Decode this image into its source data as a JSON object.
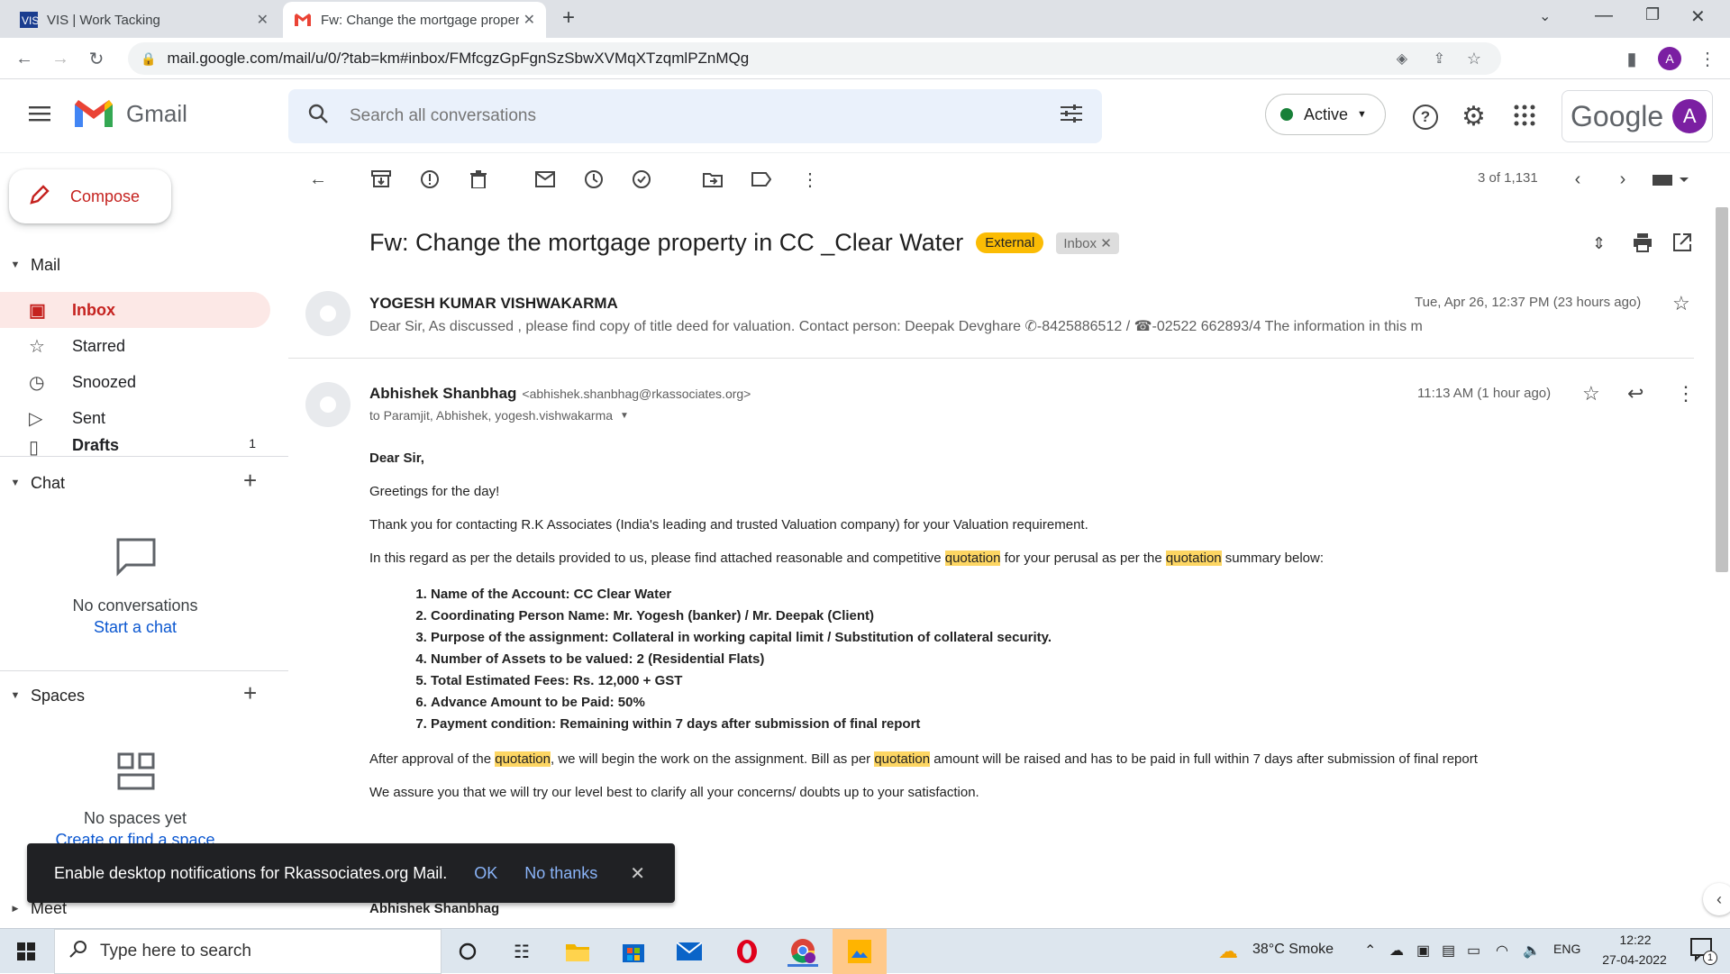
{
  "browser": {
    "tabs": [
      {
        "title": "VIS | Work Tacking",
        "active": false
      },
      {
        "title": "Fw: Change the mortgage proper",
        "active": true
      }
    ],
    "url": "mail.google.com/mail/u/0/?tab=km#inbox/FMfcgzGpFgnSzSbwXVMqXTzqmlPZnMQg",
    "profile_initial": "A"
  },
  "header": {
    "app_name": "Gmail",
    "search_placeholder": "Search all conversations",
    "status": "Active",
    "google_label": "Google",
    "avatar_initial": "A"
  },
  "sidebar": {
    "compose_label": "Compose",
    "mail_section": "Mail",
    "items": [
      {
        "label": "Inbox",
        "icon": "inbox-icon",
        "count": ""
      },
      {
        "label": "Starred",
        "icon": "star-icon",
        "count": ""
      },
      {
        "label": "Snoozed",
        "icon": "clock-icon",
        "count": ""
      },
      {
        "label": "Sent",
        "icon": "send-icon",
        "count": ""
      },
      {
        "label": "Drafts",
        "icon": "draft-icon",
        "count": "1"
      }
    ],
    "chat_section": "Chat",
    "chat_empty": "No conversations",
    "chat_link": "Start a chat",
    "spaces_section": "Spaces",
    "spaces_empty": "No spaces yet",
    "spaces_link": "Create or find a space",
    "meet_section": "Meet"
  },
  "toolbar": {
    "pagination": "3 of 1,131"
  },
  "thread": {
    "subject": "Fw: Change the mortgage property in CC _Clear Water",
    "labels": [
      "External",
      "Inbox"
    ],
    "messages": [
      {
        "sender": "YOGESH KUMAR VISHWAKARMA",
        "date": "Tue, Apr 26, 12:37 PM (23 hours ago)",
        "snippet": "Dear Sir, As discussed , please find copy of title deed for valuation. Contact person: Deepak Devghare ✆-8425886512 / ☎-02522 662893/4 The information in this m"
      },
      {
        "sender": "Abhishek Shanbhag",
        "email": "<abhishek.shanbhag@rkassociates.org>",
        "date": "11:13 AM (1 hour ago)",
        "to": "to Paramjit, Abhishek, yogesh.vishwakarma"
      }
    ]
  },
  "body": {
    "greeting": "Dear Sir,",
    "line1": "Greetings for the day!",
    "line2": "Thank you for contacting R.K Associates (India's leading and trusted Valuation company) for your Valuation requirement.",
    "line3_a": "In this regard as per the details provided to us, please find attached reasonable and competitive ",
    "line3_h1": "quotation",
    "line3_b": " for your perusal as per the ",
    "line3_h2": "quotation",
    "line3_c": " summary below:",
    "list": [
      "Name of the Account: CC Clear Water",
      "Coordinating Person Name: Mr. Yogesh (banker) / Mr. Deepak (Client)",
      "Purpose of the assignment: Collateral in working capital limit / Substitution of collateral security.",
      "Number of Assets to be valued: 2 (Residential Flats)",
      "Total Estimated Fees: Rs. 12,000 + GST",
      "Advance Amount to be Paid: 50%",
      "Payment condition: Remaining within 7 days after submission of final report"
    ],
    "line4_a": "After approval of the ",
    "line4_h1": "quotation",
    "line4_b": ", we will begin the work on the assignment. Bill as per ",
    "line4_h2": "quotation",
    "line4_c": " amount will be raised and has to be paid in full within 7 days after submission of final report",
    "line5": "We assure you that we will try our level best to clarify all your concerns/ doubts up to your satisfaction.",
    "signature": "Abhishek Shanbhag"
  },
  "snackbar": {
    "text": "Enable desktop notifications for Rkassociates.org Mail.",
    "ok": "OK",
    "no": "No thanks"
  },
  "taskbar": {
    "search_placeholder": "Type here to search",
    "weather": "38°C  Smoke",
    "lang": "ENG",
    "time": "12:22",
    "date": "27-04-2022",
    "notif_count": "1"
  }
}
